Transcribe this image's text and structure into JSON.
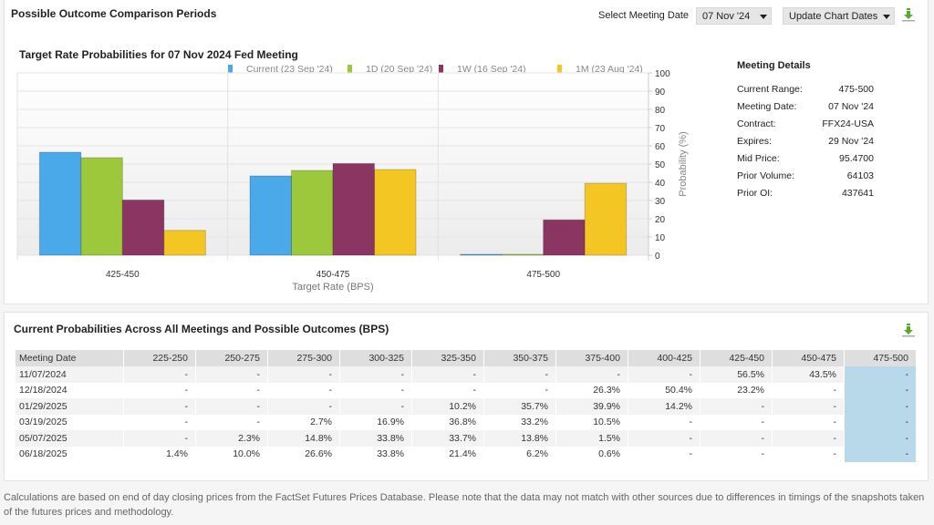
{
  "header": {
    "title": "Possible Outcome Comparison Periods",
    "select_label": "Select Meeting Date",
    "selected_meeting": "07 Nov '24",
    "update_button": "Update Chart Dates",
    "download_icon": "download-icon"
  },
  "chart_data": {
    "type": "bar",
    "title": "Target Rate Probabilities for 07 Nov 2024 Fed Meeting",
    "xlabel": "Target Rate (BPS)",
    "ylabel": "Probability (%)",
    "ylim": [
      0,
      100
    ],
    "yticks": [
      0,
      10,
      20,
      30,
      40,
      50,
      60,
      70,
      80,
      90,
      100
    ],
    "grid": true,
    "legend_position": "top",
    "categories": [
      "425-450",
      "450-475",
      "475-500"
    ],
    "series": [
      {
        "name": "Current (23 Sep '24)",
        "color": "#4aa9e9",
        "values": [
          56.5,
          43.5,
          0
        ]
      },
      {
        "name": "1D (20 Sep '24)",
        "color": "#9ec83c",
        "values": [
          53.5,
          46.5,
          0
        ]
      },
      {
        "name": "1W (16 Sep '24)",
        "color": "#8b3563",
        "values": [
          30.3,
          50.3,
          19.4
        ]
      },
      {
        "name": "1M (23 Aug '24)",
        "color": "#f4c623",
        "values": [
          13.6,
          47.0,
          39.4
        ]
      }
    ]
  },
  "meeting_details": {
    "title": "Meeting Details",
    "rows": [
      {
        "label": "Current Range:",
        "value": "475-500"
      },
      {
        "label": "Meeting Date:",
        "value": "07 Nov '24"
      },
      {
        "label": "Contract:",
        "value": "FFX24-USA"
      },
      {
        "label": "Expires:",
        "value": "29 Nov '24"
      },
      {
        "label": "Mid Price:",
        "value": "95.4700"
      },
      {
        "label": "Prior Volume:",
        "value": "64103"
      },
      {
        "label": "Prior OI:",
        "value": "437641"
      }
    ]
  },
  "probabilities_table": {
    "title": "Current Probabilities Across All Meetings and Possible Outcomes (BPS)",
    "columns": [
      "Meeting Date",
      "225-250",
      "250-275",
      "275-300",
      "300-325",
      "325-350",
      "350-375",
      "375-400",
      "400-425",
      "425-450",
      "450-475",
      "475-500"
    ],
    "highlight_column": "475-500",
    "rows": [
      [
        "11/07/2024",
        "-",
        "-",
        "-",
        "-",
        "-",
        "-",
        "-",
        "-",
        "56.5%",
        "43.5%",
        "-"
      ],
      [
        "12/18/2024",
        "-",
        "-",
        "-",
        "-",
        "-",
        "-",
        "26.3%",
        "50.4%",
        "23.2%",
        "-",
        "-"
      ],
      [
        "01/29/2025",
        "-",
        "-",
        "-",
        "-",
        "10.2%",
        "35.7%",
        "39.9%",
        "14.2%",
        "-",
        "-",
        "-"
      ],
      [
        "03/19/2025",
        "-",
        "-",
        "2.7%",
        "16.9%",
        "36.8%",
        "33.2%",
        "10.5%",
        "-",
        "-",
        "-",
        "-"
      ],
      [
        "05/07/2025",
        "-",
        "2.3%",
        "14.8%",
        "33.8%",
        "33.7%",
        "13.8%",
        "1.5%",
        "-",
        "-",
        "-",
        "-"
      ],
      [
        "06/18/2025",
        "1.4%",
        "10.0%",
        "26.6%",
        "33.8%",
        "21.4%",
        "6.2%",
        "0.6%",
        "-",
        "-",
        "-",
        "-"
      ]
    ]
  },
  "footnote": "Calculations are based on end of day closing prices from the FactSet Futures Prices Database. Please note that the data may not match with other sources due to differences in timings of the snapshots taken of the futures prices and methodology."
}
